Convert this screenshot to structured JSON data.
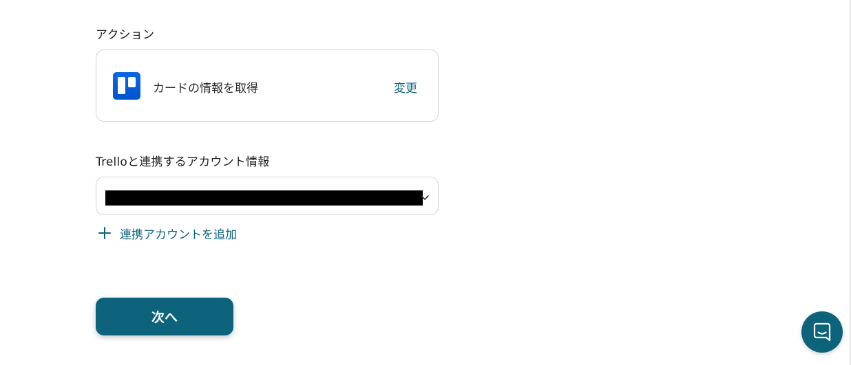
{
  "action_section": {
    "label": "アクション",
    "card": {
      "app_icon": "trello-icon",
      "action_name": "カードの情報を取得",
      "change_label": "変更"
    }
  },
  "account_section": {
    "label": "Trelloと連携するアカウント情報",
    "select_value_redacted": true,
    "add_account_label": "連携アカウントを追加",
    "add_icon": "plus-icon"
  },
  "next_button": {
    "label": "次へ"
  },
  "chat_launcher": {
    "icon": "chat-icon"
  },
  "colors": {
    "accent": "#0e637c",
    "trello_blue": "#0c66e4",
    "border": "#d3d3d3",
    "text": "#1f1f1f"
  }
}
